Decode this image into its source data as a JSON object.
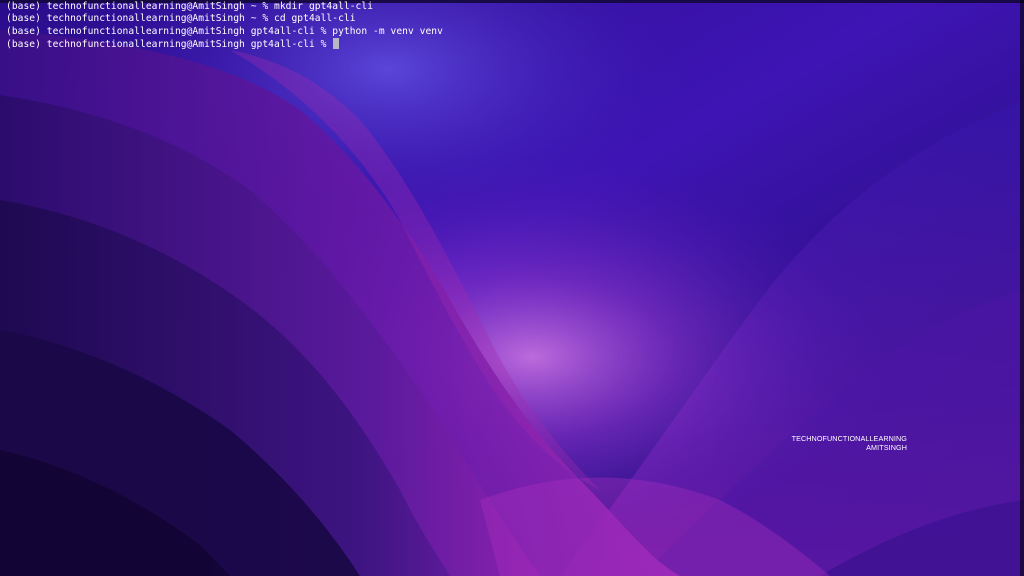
{
  "terminal": {
    "lines": [
      "(base) technofunctionallearning@AmitSingh ~ % mkdir gpt4all-cli",
      "(base) technofunctionallearning@AmitSingh ~ % cd gpt4all-cli",
      "(base) technofunctionallearning@AmitSingh gpt4all-cli % python -m venv venv"
    ],
    "current_prompt": "(base) technofunctionallearning@AmitSingh gpt4all-cli % "
  },
  "watermark": {
    "line1": "TECHNOFUNCTIONALLEARNING",
    "line2": "AMITSINGH"
  },
  "colors": {
    "text": "#ffffff",
    "cursor": "#b8b8c4",
    "wallpaper_deep": "#120633",
    "wallpaper_violet": "#3a13a8",
    "wallpaper_magenta": "#8a1aa8",
    "wallpaper_glow": "#c24bd8"
  },
  "icons": {
    "cursor": "block-cursor-icon"
  }
}
